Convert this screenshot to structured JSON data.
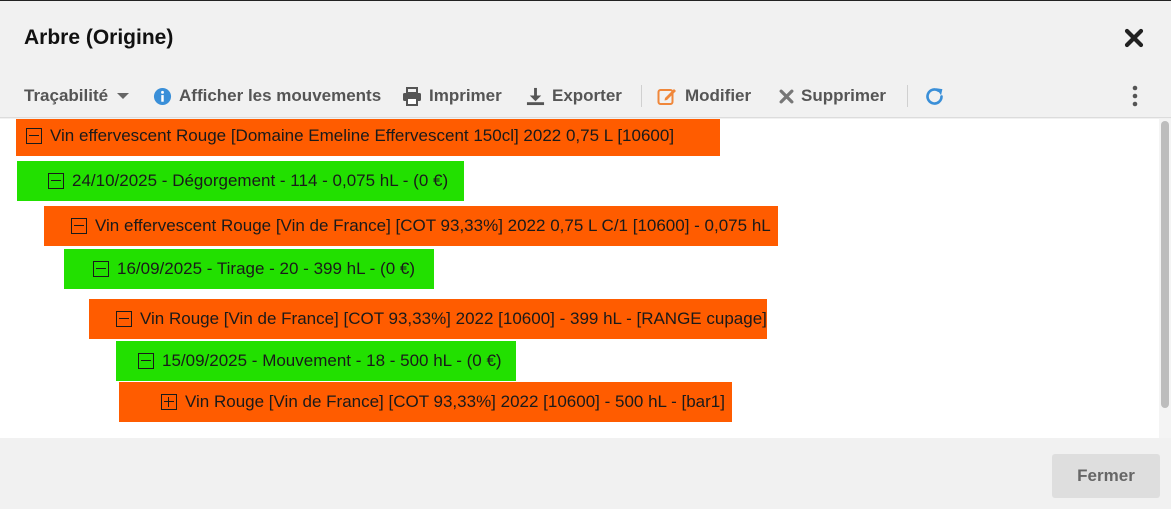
{
  "dialog": {
    "title": "Arbre (Origine)",
    "close_icon": "close-x-icon"
  },
  "toolbar": {
    "tracabilite": {
      "label": "Traçabilité",
      "icon": "caret-down-icon"
    },
    "afficher": {
      "label": "Afficher les mouvements",
      "icon": "info-circle-icon",
      "icon_color": "#3a8fd8"
    },
    "imprimer": {
      "label": "Imprimer",
      "icon": "printer-icon"
    },
    "exporter": {
      "label": "Exporter",
      "icon": "download-icon"
    },
    "modifier": {
      "label": "Modifier",
      "icon": "edit-icon",
      "icon_color": "#f0873a"
    },
    "supprimer": {
      "label": "Supprimer",
      "icon": "delete-x-icon"
    },
    "refresh": {
      "icon": "refresh-icon",
      "icon_color": "#3a8fd8"
    },
    "more": {
      "icon": "more-vertical-icon"
    }
  },
  "tree": {
    "highlight_colors": {
      "product": "#ff5c00",
      "movement": "#22e000"
    },
    "nodes": [
      {
        "label": "Vin effervescent Rouge [Domaine Emeline Effervescent 150cl] 2022 0,75 L [10600]",
        "state": "expanded",
        "kind": "product"
      },
      {
        "label": "24/10/2025 - Dégorgement - 114 - 0,075 hL - (0 €)",
        "state": "expanded",
        "kind": "movement"
      },
      {
        "label": "Vin effervescent Rouge [Vin de France] [COT 93,33%] 2022 0,75 L C/1 [10600] - 0,075 hL",
        "state": "expanded",
        "kind": "product"
      },
      {
        "label": "16/09/2025 - Tirage - 20 - 399 hL - (0 €)",
        "state": "expanded",
        "kind": "movement"
      },
      {
        "label": "Vin Rouge [Vin de France] [COT 93,33%] 2022 [10600] - 399 hL - [RANGE cupage]",
        "state": "expanded",
        "kind": "product"
      },
      {
        "label": "15/09/2025 - Mouvement - 18 - 500 hL - (0 €)",
        "state": "expanded",
        "kind": "movement"
      },
      {
        "label": "Vin Rouge [Vin de France] [COT 93,33%] 2022 [10600] - 500 hL - [bar1]",
        "state": "collapsed",
        "kind": "product"
      }
    ]
  },
  "footer": {
    "close_label": "Fermer"
  }
}
